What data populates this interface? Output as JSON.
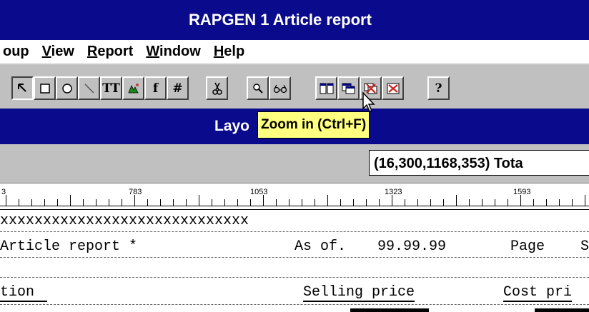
{
  "window": {
    "title": "RAPGEN 1 Article report"
  },
  "menu": [
    {
      "label": "oup",
      "accel": ""
    },
    {
      "label": "View",
      "accel": "V"
    },
    {
      "label": "Report",
      "accel": "R"
    },
    {
      "label": "Window",
      "accel": "W"
    },
    {
      "label": "Help",
      "accel": "H"
    }
  ],
  "toolbar": {
    "text_tool": "TT",
    "formula_tool": "f",
    "number_tool": "#",
    "help_tool": "?"
  },
  "layout_bar": {
    "label": "Layo"
  },
  "tooltip": {
    "text": "Zoom in (Ctrl+F)"
  },
  "info": {
    "coords": "(16,300,1168,353) Tota"
  },
  "ruler": {
    "labels": [
      "3",
      "783",
      "1053",
      "1323",
      "1593"
    ]
  },
  "report": {
    "xline": "xxxxxxxxxxxxxxxxxxxxxxxxxxxxx",
    "header_left": "Article report *",
    "as_of_label": "As of.",
    "as_of_value": "99.99.99",
    "page_label": "Page",
    "page_value": "S",
    "col_description": "tion",
    "col_selling": "Selling price",
    "col_cost": "Cost pri"
  }
}
